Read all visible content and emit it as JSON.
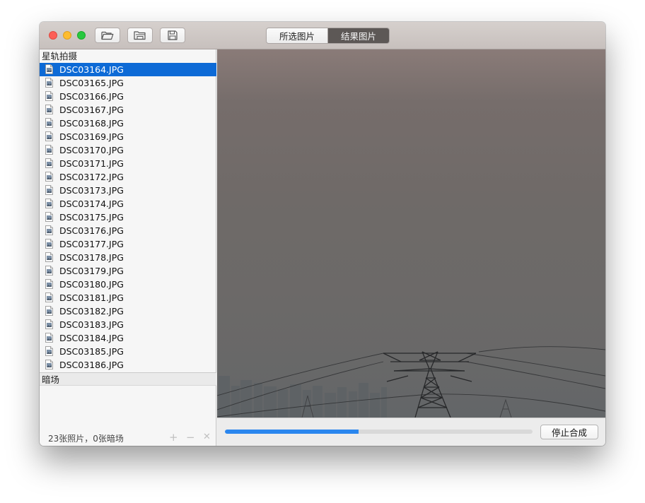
{
  "toolbar": {
    "buttons": [
      {
        "icon": "folder-open-icon"
      },
      {
        "icon": "folder-open-alt-icon"
      },
      {
        "icon": "save-icon"
      }
    ],
    "segments": [
      "所选图片",
      "结果图片"
    ],
    "active_segment": 1
  },
  "sidebar": {
    "section1_title": "星轨拍摄",
    "files": [
      "DSC03164.JPG",
      "DSC03165.JPG",
      "DSC03166.JPG",
      "DSC03167.JPG",
      "DSC03168.JPG",
      "DSC03169.JPG",
      "DSC03170.JPG",
      "DSC03171.JPG",
      "DSC03172.JPG",
      "DSC03173.JPG",
      "DSC03174.JPG",
      "DSC03175.JPG",
      "DSC03176.JPG",
      "DSC03177.JPG",
      "DSC03178.JPG",
      "DSC03179.JPG",
      "DSC03180.JPG",
      "DSC03181.JPG",
      "DSC03182.JPG",
      "DSC03183.JPG",
      "DSC03184.JPG",
      "DSC03185.JPG",
      "DSC03186.JPG"
    ],
    "selected_index": 0,
    "section2_title": "暗场",
    "status": "23张照片，0张暗场",
    "controls": {
      "add": "+",
      "remove": "−",
      "clear": "✕"
    }
  },
  "preview": {
    "description_icon": "night-sky-power-tower-image"
  },
  "progress": {
    "fraction": 0.435,
    "stop_label": "停止合成"
  },
  "colors": {
    "accent": "#0d6ad6",
    "progress": "#2a86ee"
  }
}
